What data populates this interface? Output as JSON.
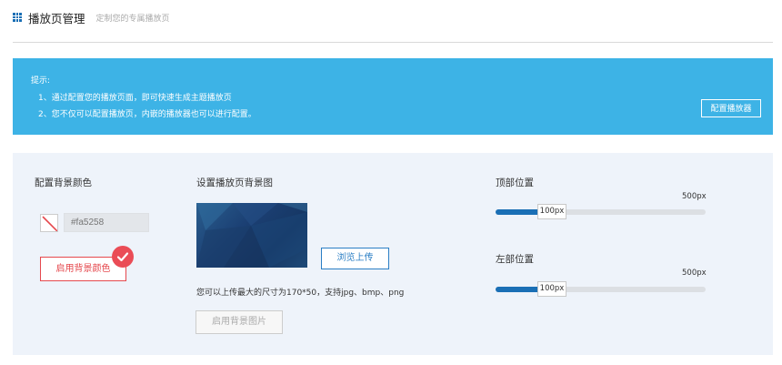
{
  "header": {
    "title": "播放页管理",
    "subtitle": "定制您的专属播放页",
    "icon": "grid-icon"
  },
  "notice": {
    "title": "提示:",
    "line1": "1、通过配置您的播放页面，即可快速生成主题播放页",
    "line2": "2、您不仅可以配置播放页，内嵌的播放器也可以进行配置。",
    "config_button": "配置播放器",
    "bg_color": "#3db3e6"
  },
  "bg_color_section": {
    "label": "配置背景颜色",
    "color_placeholder": "#fa5258",
    "enable_button": "启用背景颜色",
    "checked": true,
    "accent_color": "#e5484d"
  },
  "bg_image_section": {
    "label": "设置播放页背景图",
    "browse_button": "浏览上传",
    "hint": "您可以上传最大的尺寸为170*50，支持jpg、bmp、png",
    "enable_button": "启用背景图片"
  },
  "top_position": {
    "label": "顶部位置",
    "max": "500px",
    "value": "100px",
    "fraction": 0.2
  },
  "left_position": {
    "label": "左部位置",
    "max": "500px",
    "value": "100px",
    "fraction": 0.2
  }
}
